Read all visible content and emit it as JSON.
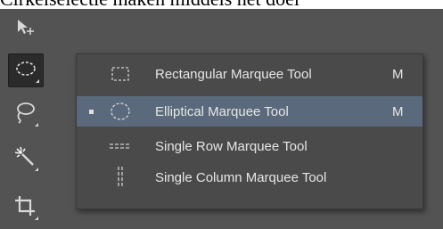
{
  "caption": {
    "text": "Cirkelselectie maken middels het doel"
  },
  "toolbar": {
    "tools": [
      {
        "icon": "move-artboard-icon"
      },
      {
        "icon": "elliptical-marquee-icon",
        "active": true
      },
      {
        "icon": "lasso-icon"
      },
      {
        "icon": "magic-wand-icon"
      },
      {
        "icon": "crop-icon"
      }
    ]
  },
  "flyout": {
    "items": [
      {
        "label": "Rectangular Marquee Tool",
        "shortcut": "M",
        "icon": "rectangular-marquee-icon",
        "selected": false
      },
      {
        "label": "Elliptical Marquee Tool",
        "shortcut": "M",
        "icon": "elliptical-marquee-icon",
        "selected": true
      },
      {
        "label": "Single Row Marquee Tool",
        "shortcut": "",
        "icon": "single-row-marquee-icon",
        "selected": false
      },
      {
        "label": "Single Column Marquee Tool",
        "shortcut": "",
        "icon": "single-column-marquee-icon",
        "selected": false
      }
    ]
  },
  "colors": {
    "panel": "#535353",
    "flyout": "#4a4a4a",
    "selected": "#5a6a7c",
    "text": "#e6e6e6"
  }
}
